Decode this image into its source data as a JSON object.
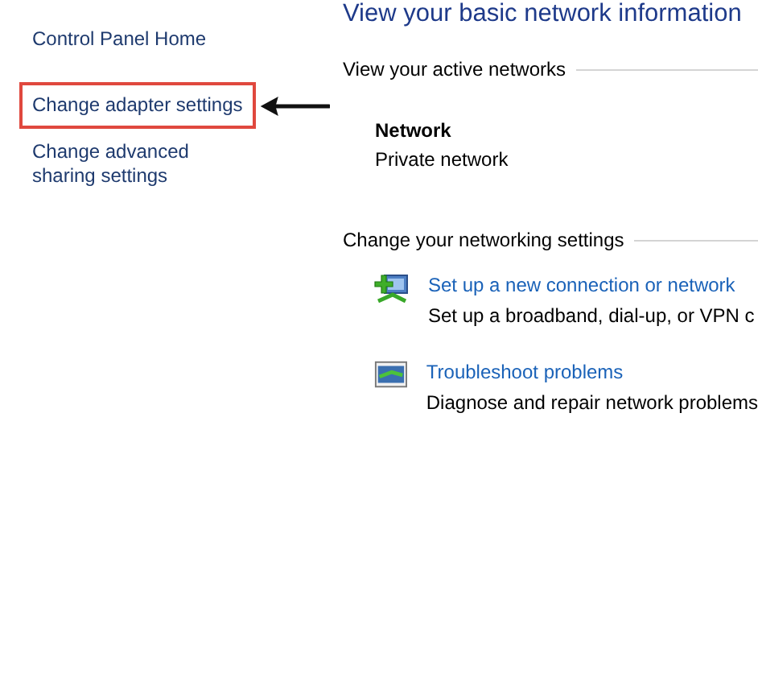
{
  "sidebar": {
    "items": [
      {
        "label": "Control Panel Home",
        "highlighted": false
      },
      {
        "label": "Change adapter settings",
        "highlighted": true
      },
      {
        "label": "Change advanced sharing settings",
        "highlighted": false
      }
    ]
  },
  "main": {
    "title": "View your basic network information",
    "active_networks": {
      "heading": "View your active networks",
      "network_name": "Network",
      "network_type": "Private network"
    },
    "settings": {
      "heading": "Change your networking settings",
      "tasks": [
        {
          "kind": "new-connection",
          "link": "Set up a new connection or network",
          "description": "Set up a broadband, dial-up, or VPN c"
        },
        {
          "kind": "troubleshoot",
          "link": "Troubleshoot problems",
          "description": "Diagnose and repair network problems"
        }
      ]
    }
  }
}
